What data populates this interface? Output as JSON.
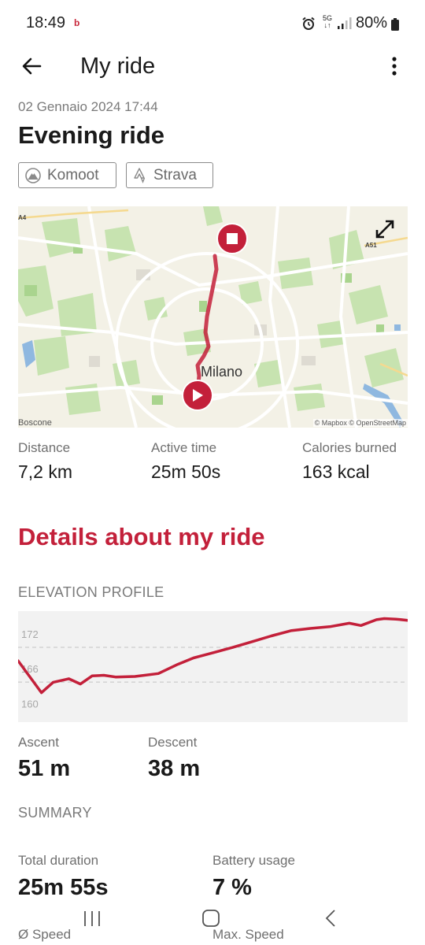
{
  "status": {
    "time": "18:49",
    "notification": "b",
    "network": "5G",
    "battery": "80%"
  },
  "header": {
    "title": "My ride"
  },
  "ride": {
    "date": "02 Gennaio 2024 17:44",
    "name": "Evening ride",
    "chips": [
      "Komoot",
      "Strava"
    ]
  },
  "map": {
    "city_label": "Milano",
    "area_label": "Boscone",
    "road_a4": "A4",
    "road_a51": "A51",
    "attribution": "© Mapbox © OpenStreetMap",
    "route_color": "#c3203a"
  },
  "stats": {
    "distance_label": "Distance",
    "distance_value": "7,2 km",
    "active_label": "Active time",
    "active_value": "25m 50s",
    "calories_label": "Calories burned",
    "calories_value": "163 kcal"
  },
  "details": {
    "heading": "Details about my ride",
    "elevation_heading": "ELEVATION PROFILE",
    "ascent_label": "Ascent",
    "ascent_value": "51 m",
    "descent_label": "Descent",
    "descent_value": "38 m",
    "summary_heading": "SUMMARY",
    "total_duration_label": "Total duration",
    "total_duration_value": "25m 55s",
    "battery_label": "Battery usage",
    "battery_value": "7 %",
    "avg_speed_label": "Ø Speed",
    "max_speed_label": "Max. Speed"
  },
  "chart_data": {
    "type": "area",
    "title": "",
    "xlabel": "",
    "ylabel": "",
    "ylim": [
      158,
      175
    ],
    "yticks": [
      160,
      166,
      172
    ],
    "grid": "dashed at 166 and 172",
    "line_color": "#c3203a",
    "series": [
      {
        "x": [
          0,
          0.06,
          0.09,
          0.13,
          0.16,
          0.19,
          0.22,
          0.25,
          0.3,
          0.36,
          0.41,
          0.45,
          0.5,
          0.55,
          0.6,
          0.65,
          0.7,
          0.75,
          0.8,
          0.85,
          0.88,
          0.92,
          0.94,
          0.97,
          1.0
        ],
        "y": [
          167.5,
          162.0,
          163.8,
          164.4,
          163.5,
          164.9,
          165.0,
          164.7,
          164.8,
          165.3,
          166.9,
          168.0,
          168.9,
          169.8,
          170.8,
          171.8,
          172.7,
          173.1,
          173.4,
          174.0,
          173.6,
          174.6,
          174.8,
          174.7,
          174.5
        ]
      }
    ]
  },
  "navbar": {
    "recents": "recents-icon",
    "home": "home-icon",
    "back": "back-icon"
  }
}
